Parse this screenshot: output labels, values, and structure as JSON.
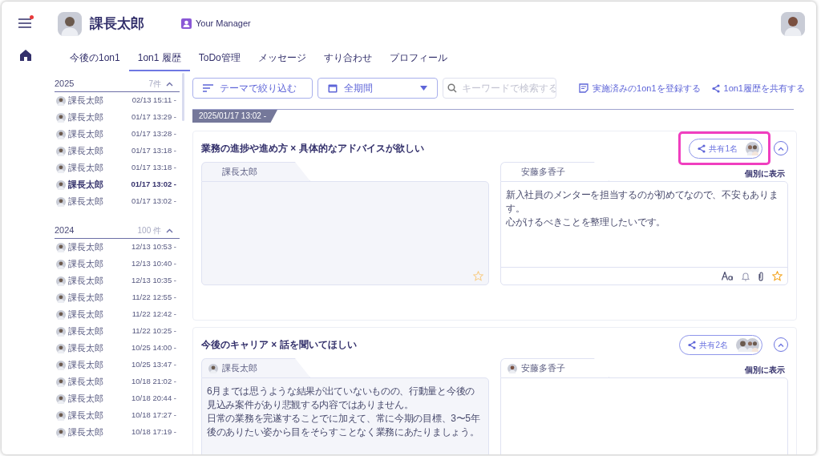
{
  "header": {
    "user_name": "課長太郎",
    "role_label": "Your Manager",
    "notification_dot": true
  },
  "tabs": [
    {
      "label": "今後の1on1",
      "selected": false
    },
    {
      "label": "1on1 履歴",
      "selected": true
    },
    {
      "label": "ToDo管理",
      "selected": false
    },
    {
      "label": "メッセージ",
      "selected": false
    },
    {
      "label": "すり合わせ",
      "selected": false
    },
    {
      "label": "プロフィール",
      "selected": false
    }
  ],
  "sidebar": {
    "groups": [
      {
        "year": "2025",
        "count": "7件",
        "expanded": true,
        "items": [
          {
            "name": "課長太郎",
            "time": "02/13 15:11 -",
            "selected": false
          },
          {
            "name": "課長太郎",
            "time": "01/17 13:29 -",
            "selected": false
          },
          {
            "name": "課長太郎",
            "time": "01/17 13:28 -",
            "selected": false
          },
          {
            "name": "課長太郎",
            "time": "01/17 13:18 -",
            "selected": false
          },
          {
            "name": "課長太郎",
            "time": "01/17 13:18 -",
            "selected": false
          },
          {
            "name": "課長太郎",
            "time": "01/17 13:02 -",
            "selected": true
          },
          {
            "name": "課長太郎",
            "time": "01/17 13:02 -",
            "selected": false
          }
        ]
      },
      {
        "year": "2024",
        "count": "100 件",
        "expanded": true,
        "items": [
          {
            "name": "課長太郎",
            "time": "12/13 10:53 -",
            "selected": false
          },
          {
            "name": "課長太郎",
            "time": "12/13 10:40 -",
            "selected": false
          },
          {
            "name": "課長太郎",
            "time": "12/13 10:35 -",
            "selected": false
          },
          {
            "name": "課長太郎",
            "time": "11/22 12:55 -",
            "selected": false
          },
          {
            "name": "課長太郎",
            "time": "11/22 12:42 -",
            "selected": false
          },
          {
            "name": "課長太郎",
            "time": "11/22 10:25 -",
            "selected": false
          },
          {
            "name": "課長太郎",
            "time": "10/25 14:00 -",
            "selected": false
          },
          {
            "name": "課長太郎",
            "time": "10/25 13:47 -",
            "selected": false
          },
          {
            "name": "課長太郎",
            "time": "10/18 21:02 -",
            "selected": false
          },
          {
            "name": "課長太郎",
            "time": "10/18 20:44 -",
            "selected": false
          },
          {
            "name": "課長太郎",
            "time": "10/18 17:27 -",
            "selected": false
          },
          {
            "name": "課長太郎",
            "time": "10/18 17:19 -",
            "selected": false
          }
        ]
      }
    ]
  },
  "toolbar": {
    "theme_filter": "テーマで絞り込む",
    "period": "全期間",
    "search_placeholder": "キーワードで検索する",
    "register_link": "実施済みの1on1を登録する",
    "share_link": "1on1履歴を共有する"
  },
  "session_date": "2025/01/17 13:02 -",
  "cards": [
    {
      "title": "業務の進捗や進め方 × 具体的なアドバイスが欲しい",
      "share_label": "共有1名",
      "shared_avatars": [
        {
          "kind": "group"
        }
      ],
      "highlighted": true,
      "expanded": true,
      "left": {
        "name": "課長太郎",
        "show_avatar": false,
        "starred": false
      },
      "right": {
        "name": "安藤多香子",
        "show_avatar": false,
        "individual_label": "個別に表示",
        "lines": [
          "新入社員のメンターを担当するのが初めてなので、不安もあります。",
          "心がけるべきことを整理したいです。"
        ],
        "starred": true,
        "toolbar": true
      }
    },
    {
      "title": "今後のキャリア × 話を聞いてほしい",
      "share_label": "共有2名",
      "shared_avatars": [
        {
          "kind": "male"
        },
        {
          "kind": "group"
        }
      ],
      "highlighted": false,
      "expanded": true,
      "left": {
        "name": "課長太郎",
        "show_avatar": true,
        "lines": [
          "6月までは思うような結果が出ていないものの、行動量と今後の見込み案件があり悲観する内容ではありません。",
          "日常の業務を完遂することでに加えて、常に今期の目標、3〜5年後のありたい姿から目をそらすことなく業務にあたりましょう。"
        ]
      },
      "right": {
        "name": "安藤多香子",
        "show_avatar": true,
        "individual_label": "個別に表示"
      }
    }
  ]
}
